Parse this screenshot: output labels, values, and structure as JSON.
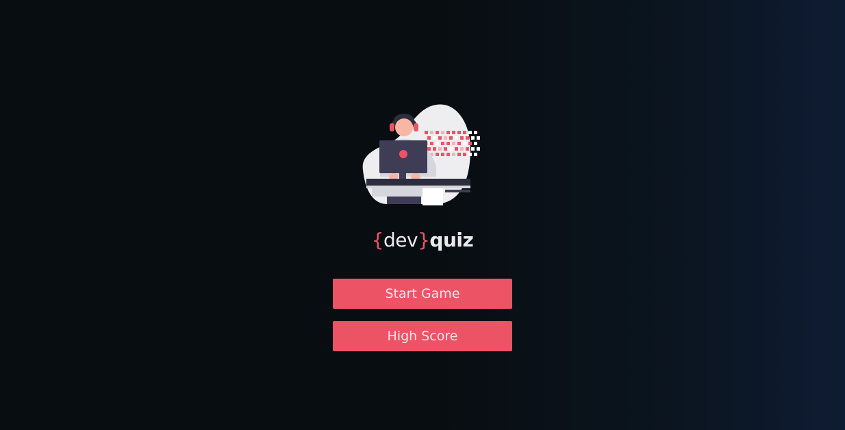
{
  "logo": {
    "open_brace": "{",
    "dev": "dev",
    "close_brace": "}",
    "quiz": "quiz"
  },
  "buttons": {
    "start_label": "Start Game",
    "high_score_label": "High Score"
  },
  "colors": {
    "accent": "#ec5466",
    "background": "#080d11",
    "text": "#e9eaec"
  },
  "illustration": {
    "icon": "developer-at-laptop-illustration"
  }
}
